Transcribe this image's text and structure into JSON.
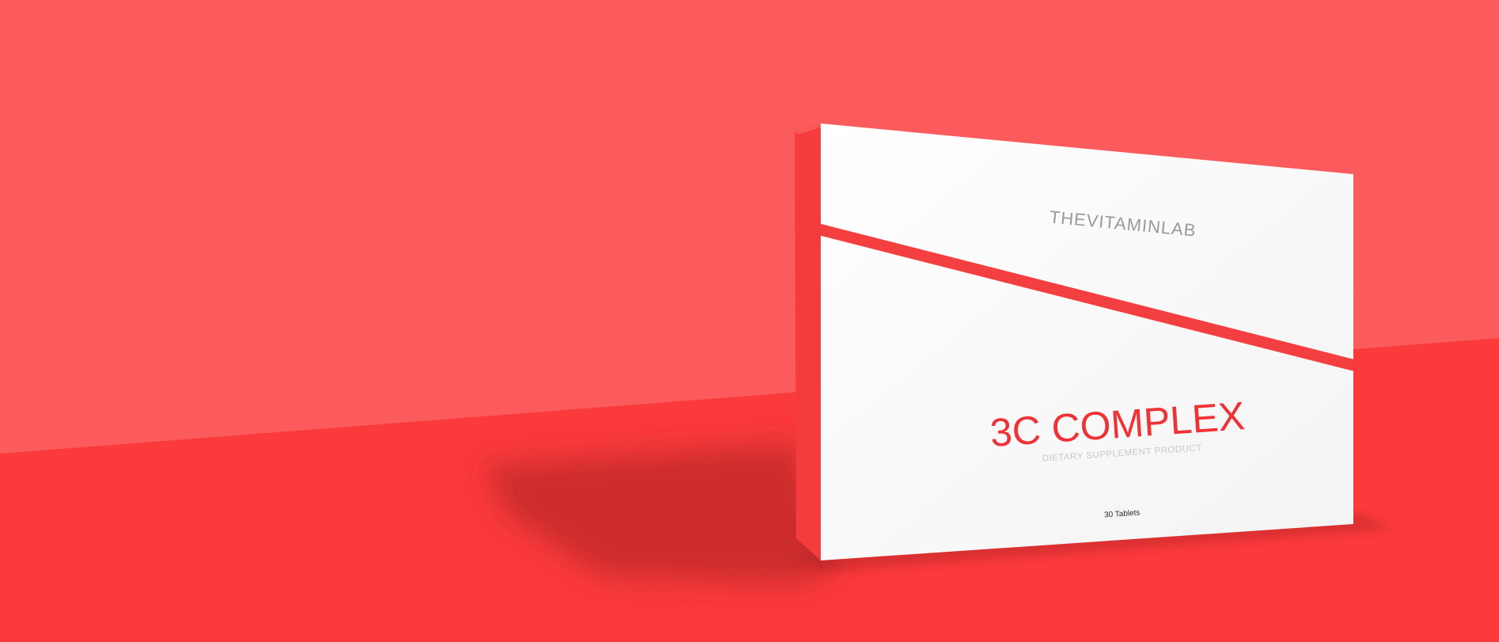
{
  "product": {
    "brand": "THEVITAMINLAB",
    "name": "3C COMPLEX",
    "subtitle": "DIETARY SUPPLEMENT PRODUCT",
    "quantity": "30 Tablets"
  },
  "colors": {
    "wall": "#fb5b5c",
    "floor": "#fb3a3b",
    "shadow": "#c42a2c",
    "box_front": "#fbfbfb",
    "box_side": "#f53c3d",
    "stripe": "#f33f40",
    "brand_text": "#9a9a9a",
    "name_text": "#ee3235",
    "subtitle_text": "#c8c8c8",
    "quantity_text": "#2a2a2a"
  }
}
